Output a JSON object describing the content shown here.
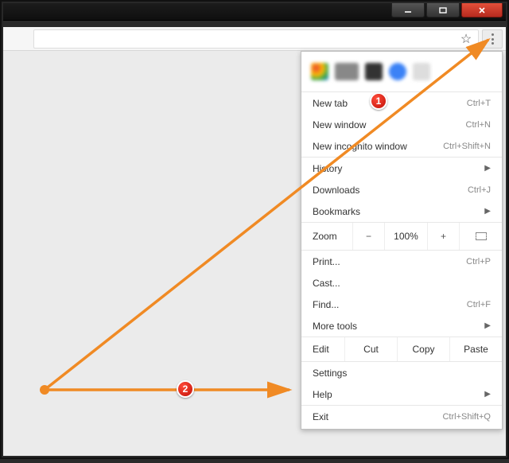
{
  "window": {
    "minimize_tip": "Minimize",
    "maximize_tip": "Maximize",
    "close_tip": "Close"
  },
  "toolbar": {
    "star_tip": "Bookmark this page",
    "menu_tip": "Customize and control Google Chrome"
  },
  "menu": {
    "new_tab": {
      "label": "New tab",
      "shortcut": "Ctrl+T"
    },
    "new_window": {
      "label": "New window",
      "shortcut": "Ctrl+N"
    },
    "new_incognito": {
      "label": "New incognito window",
      "shortcut": "Ctrl+Shift+N"
    },
    "history": {
      "label": "History"
    },
    "downloads": {
      "label": "Downloads",
      "shortcut": "Ctrl+J"
    },
    "bookmarks": {
      "label": "Bookmarks"
    },
    "zoom": {
      "label": "Zoom",
      "minus": "−",
      "pct": "100%",
      "plus": "+"
    },
    "print": {
      "label": "Print...",
      "shortcut": "Ctrl+P"
    },
    "cast": {
      "label": "Cast..."
    },
    "find": {
      "label": "Find...",
      "shortcut": "Ctrl+F"
    },
    "more_tools": {
      "label": "More tools"
    },
    "edit": {
      "label": "Edit",
      "cut": "Cut",
      "copy": "Copy",
      "paste": "Paste"
    },
    "settings": {
      "label": "Settings"
    },
    "help": {
      "label": "Help"
    },
    "exit": {
      "label": "Exit",
      "shortcut": "Ctrl+Shift+Q"
    }
  },
  "annotations": {
    "step1": "1",
    "step2": "2"
  }
}
